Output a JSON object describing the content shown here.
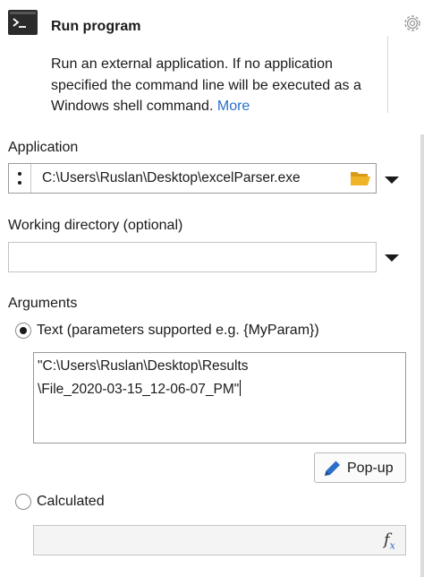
{
  "header": {
    "title": "Run program",
    "description": "Run an external application. If no application specified the command line will be executed as a Windows shell command.",
    "more_link": "More"
  },
  "application": {
    "label": "Application",
    "value": "C:\\Users\\Ruslan\\Desktop\\excelParser.exe"
  },
  "working_directory": {
    "label": "Working directory (optional)",
    "value": ""
  },
  "arguments": {
    "label": "Arguments",
    "text_option_label": "Text (parameters supported e.g. {MyParam})",
    "text_option_selected": true,
    "text_value_line1": "\"C:\\Users\\Ruslan\\Desktop\\Results",
    "text_value_line2": "\\File_2020-03-15_12-06-07_PM\"",
    "popup_button_label": "Pop-up",
    "calculated_option_label": "Calculated",
    "calculated_option_selected": false,
    "calculated_value": ""
  },
  "icons": {
    "app": "terminal-icon",
    "settings": "gear-icon",
    "app_menu": "kebab-menu-icon",
    "browse": "folder-open-icon",
    "dropdown": "chevron-down-icon",
    "popup": "pencil-icon",
    "function": "fx-icon"
  },
  "colors": {
    "link": "#2a6fc9",
    "folder": "#f0b429",
    "icon_bg": "#2b2b2b"
  }
}
